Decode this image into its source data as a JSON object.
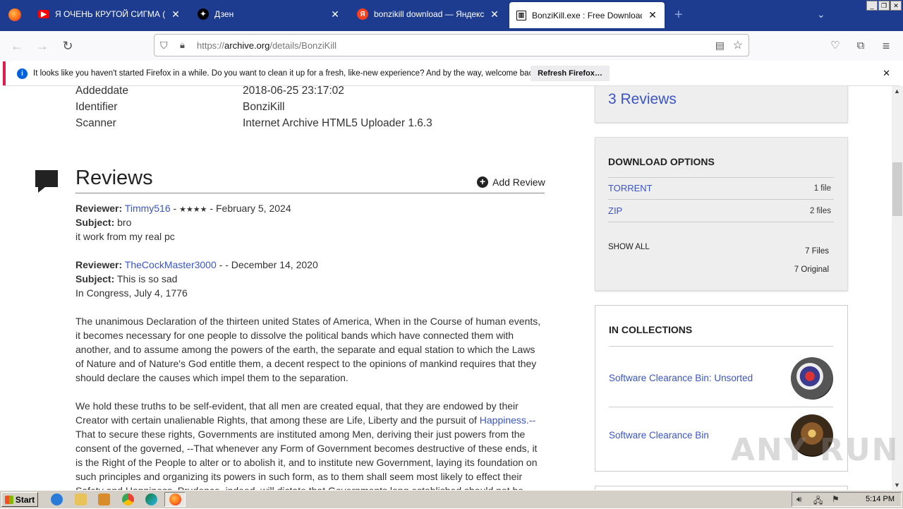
{
  "browser": {
    "tabs": [
      {
        "title": "Я ОЧЕНЬ КРУТОЙ СИГМА (PHONK",
        "favicon": "youtube-icon",
        "color": "#ff0000"
      },
      {
        "title": "Дзен",
        "favicon": "dzen-icon",
        "color": "#000000"
      },
      {
        "title": "bonzikill download — Яндекс: наш",
        "favicon": "yandex-icon",
        "color": "#fc3f1d"
      },
      {
        "title": "BonziKill.exe : Free Download, Borr",
        "favicon": "archive-icon",
        "color": "#111111"
      }
    ],
    "new_tab": "+",
    "url_prefix": "https://",
    "url_host": "archive.org",
    "url_path": "/details/BonziKill",
    "notification": "It looks like you haven't started Firefox in a while. Do you want to clean it up for a fresh, like-new experience? And by the way, welcome back!",
    "refresh_label": "Refresh Firefox…"
  },
  "metadata": [
    {
      "label": "Addeddate",
      "value": "2018-06-25 23:17:02"
    },
    {
      "label": "Identifier",
      "value": "BonziKill"
    },
    {
      "label": "Scanner",
      "value": "Internet Archive HTML5 Uploader 1.6.3"
    }
  ],
  "reviews": {
    "heading": "Reviews",
    "add_review": "Add Review",
    "items": [
      {
        "reviewer_label": "Reviewer:",
        "reviewer": "Timmy516",
        "stars": "★★★★",
        "date": "February 5, 2024",
        "subject_label": "Subject:",
        "subject": "bro",
        "body": "it work from my real pc"
      },
      {
        "reviewer_label": "Reviewer:",
        "reviewer": "TheCockMaster3000",
        "stars": "",
        "date": "December 14, 2020",
        "subject_label": "Subject:",
        "subject": "This is so sad",
        "body_intro": "In Congress, July 4, 1776",
        "para1": "The unanimous Declaration of the thirteen united States of America, When in the Course of human events, it becomes necessary for one people to dissolve the political bands which have connected them with another, and to assume among the powers of the earth, the separate and equal station to which the Laws of Nature and of Nature's God entitle them, a decent respect to the opinions of mankind requires that they should declare the causes which impel them to the separation.",
        "para2a": "We hold these truths to be self-evident, that all men are created equal, that they are endowed by their Creator with certain unalienable Rights, that among these are Life, Liberty and the pursuit of",
        "para2_link": "Happiness.--",
        "para2b": "That to secure these rights, Governments are instituted among Men, deriving their just powers from the consent of the governed, --That whenever any Form of Government becomes destructive of these ends, it is the Right of the People to alter or to abolish it, and to institute new Government, laying its foundation on such principles and organizing its powers in such form, as to them shall seem most likely to effect their Safety and Happiness. Prudence, indeed, will dictate that Governments long established should not be"
      }
    ]
  },
  "sidebar": {
    "reviews_count": "3 Reviews",
    "download": {
      "title": "DOWNLOAD OPTIONS",
      "rows": [
        {
          "label": "TORRENT",
          "count": "1 file"
        },
        {
          "label": "ZIP",
          "count": "2 files"
        }
      ],
      "show_all": "SHOW ALL",
      "total_files": "7 Files",
      "original": "7 Original"
    },
    "collections": {
      "title": "IN COLLECTIONS",
      "items": [
        {
          "label": "Software Clearance Bin: Unsorted"
        },
        {
          "label": "Software Clearance Bin"
        }
      ]
    }
  },
  "taskbar": {
    "start": "Start",
    "clock": "5:14 PM"
  },
  "watermark": "ANY RUN"
}
